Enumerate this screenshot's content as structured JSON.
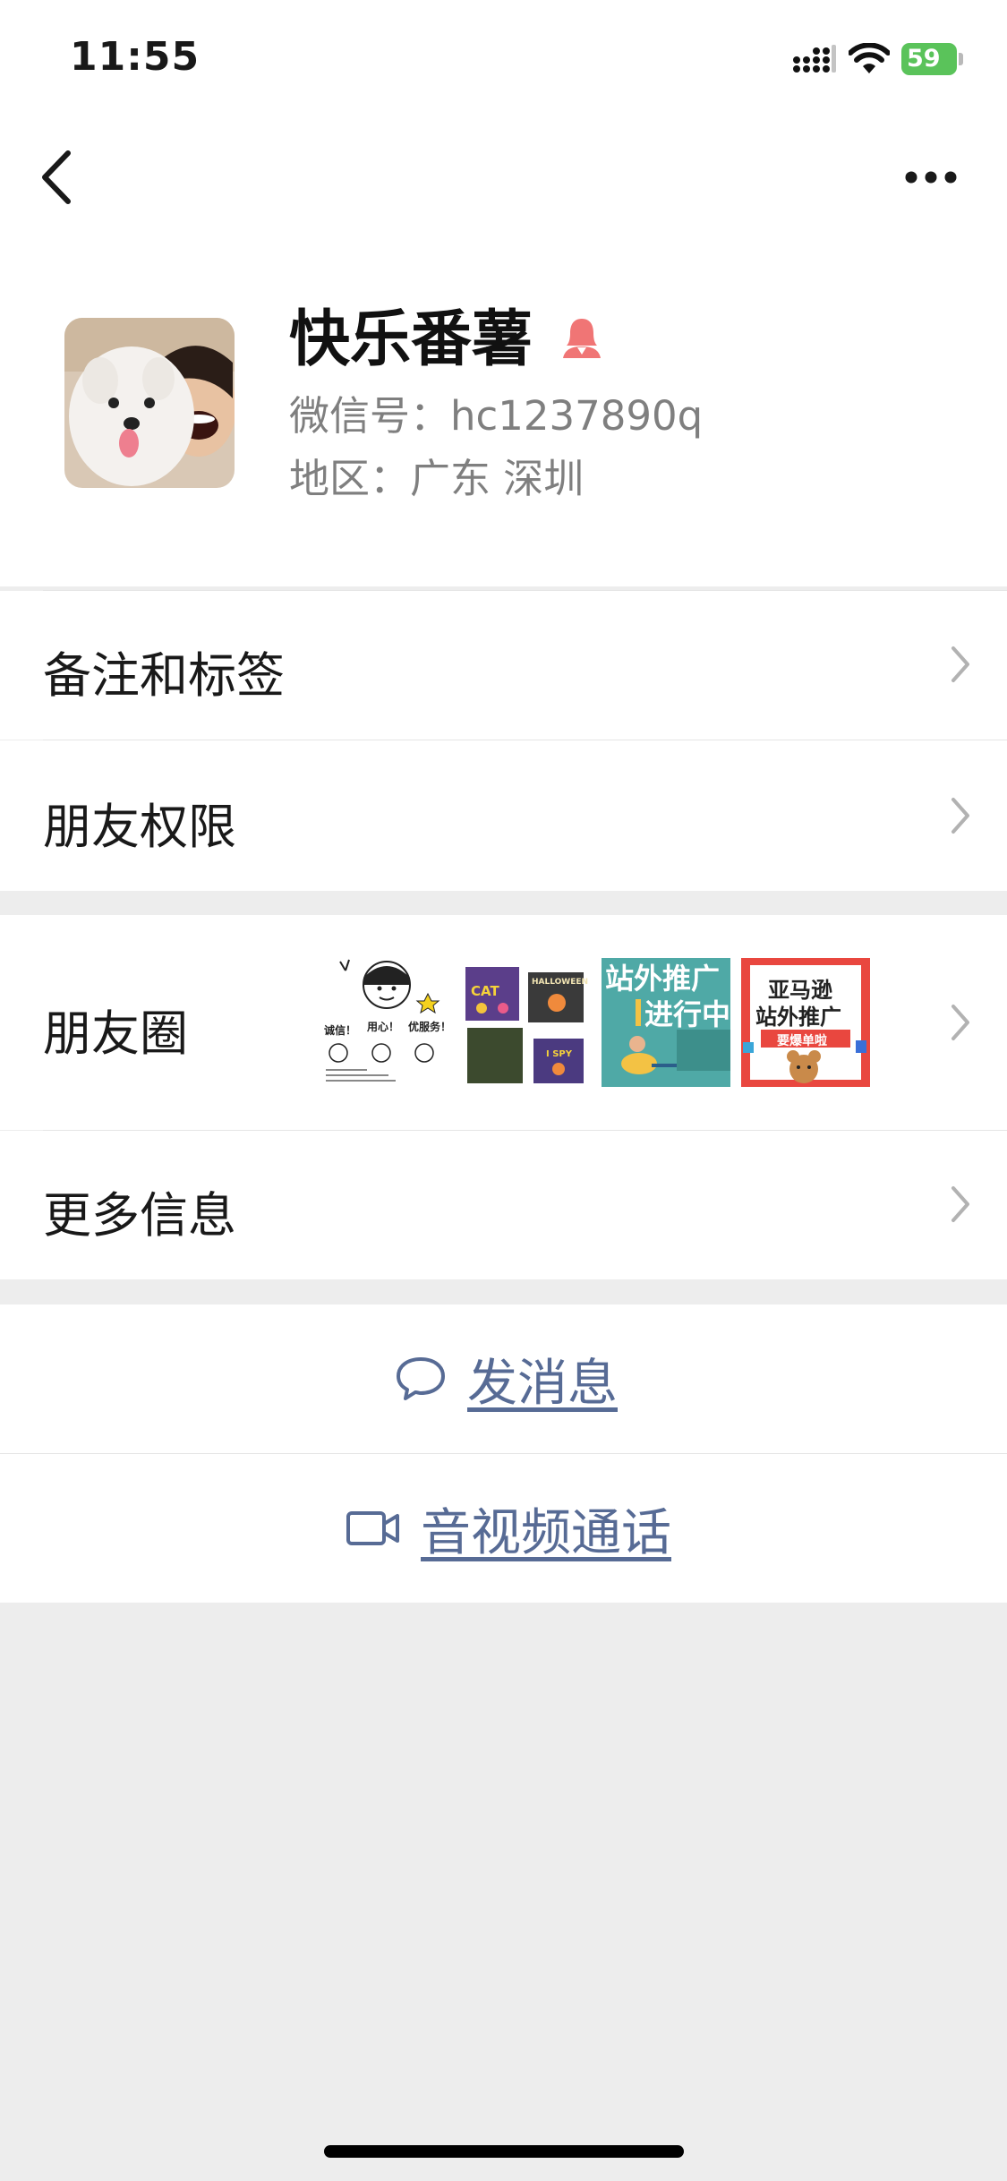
{
  "status_bar": {
    "time": "11:55",
    "battery": "59"
  },
  "profile": {
    "name": "快乐番薯",
    "wechat_id": "微信号：hc1237890q",
    "region": "地区：广东 深圳"
  },
  "menu": {
    "remarks_tags": "备注和标签",
    "friend_permissions": "朋友权限",
    "moments": "朋友圈",
    "more_info": "更多信息"
  },
  "moments_thumbs": {
    "t1": {
      "a": "诚信！",
      "b": "用心！",
      "c": "优服务！"
    },
    "t2": {
      "a": "CAT",
      "b": "HALLOWEEN",
      "c": "I SPY"
    },
    "t3": {
      "a": "站外推广",
      "b": "进行中"
    },
    "t4": {
      "a": "亚马逊",
      "b": "站外推广",
      "c": "要爆单啦"
    }
  },
  "actions": {
    "message": "发消息",
    "call": "音视频通话"
  },
  "colors": {
    "link": "#576b95",
    "background": "#ededed",
    "gender_female": "#f07575"
  }
}
